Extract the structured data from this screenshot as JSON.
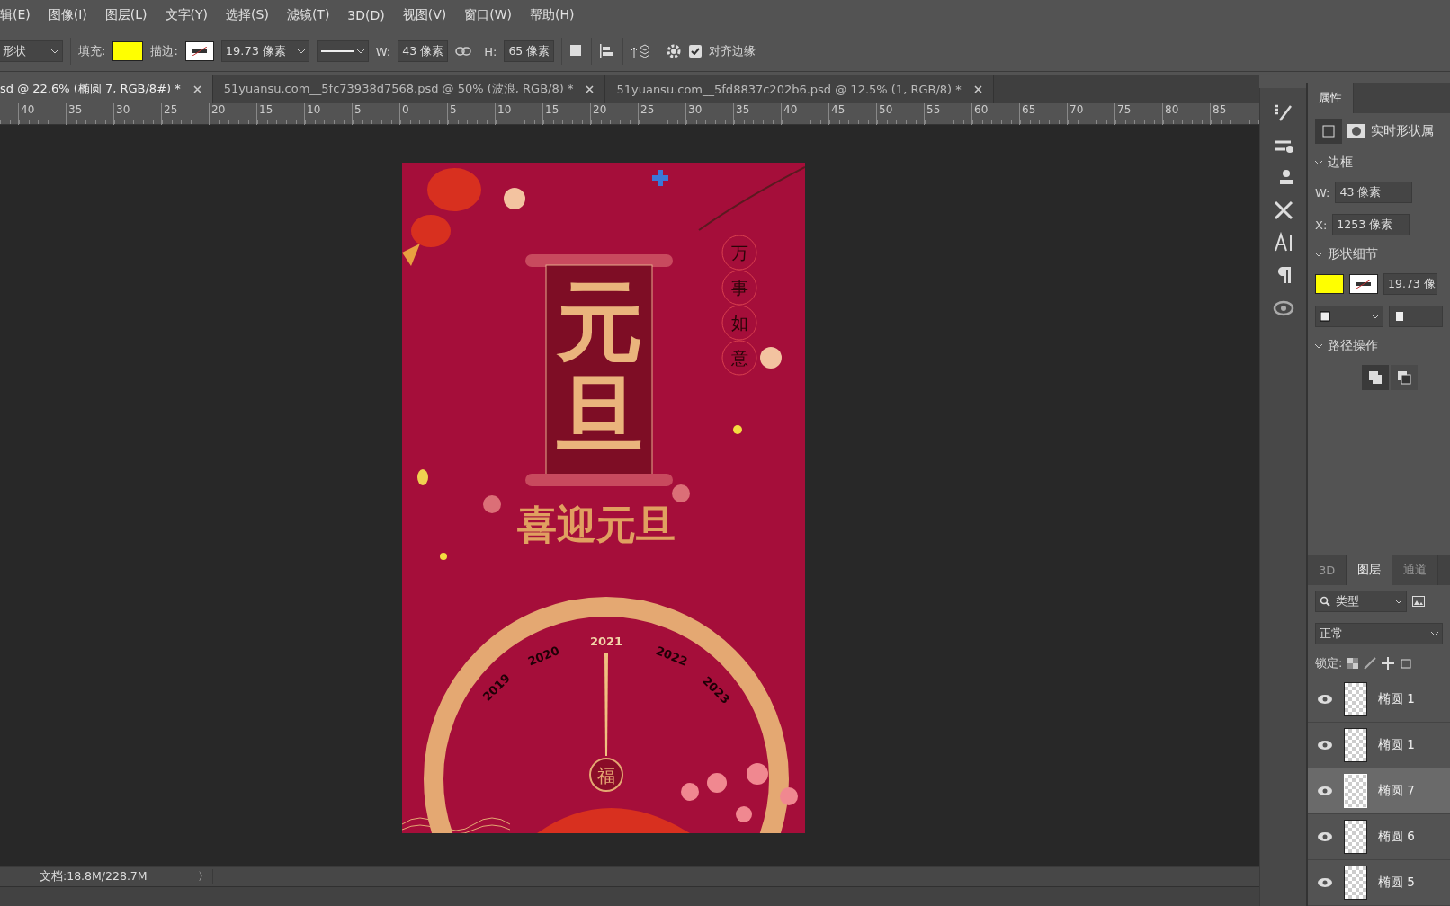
{
  "menu": [
    "辑(E)",
    "图像(I)",
    "图层(L)",
    "文字(Y)",
    "选择(S)",
    "滤镜(T)",
    "3D(D)",
    "视图(V)",
    "窗口(W)",
    "帮助(H)"
  ],
  "options": {
    "tool_preset": "形状",
    "fill_label": "填充:",
    "stroke_label": "描边:",
    "stroke_width": "19.73 像素",
    "width_label": "W:",
    "width": "43 像素",
    "height_label": "H:",
    "height": "65 像素",
    "snap": {
      "label": "对齐边缘",
      "checked": true
    }
  },
  "tabs": [
    {
      "label": "sd @ 22.6% (椭圆 7, RGB/8#) *",
      "selected": true
    },
    {
      "label": "51yuansu.com__5fc73938d7568.psd @ 50% (波浪, RGB/8) *",
      "selected": false
    },
    {
      "label": "51yuansu.com__5fd8837c202b6.psd @ 12.5% (1, RGB/8) *",
      "selected": false
    }
  ],
  "ruler": [
    "40",
    "35",
    "30",
    "25",
    "20",
    "15",
    "10",
    "5",
    "0",
    "5",
    "10",
    "15",
    "20",
    "25",
    "30",
    "35",
    "40",
    "45",
    "50",
    "55",
    "60",
    "65",
    "70",
    "75",
    "80",
    "85"
  ],
  "poster": {
    "scroll_text": "元旦",
    "blessing": "万事如意",
    "headline": "喜迎元旦",
    "years": [
      "2019",
      "2020",
      "2021",
      "2022",
      "2023"
    ],
    "seal": "福"
  },
  "status_bar": {
    "doc": "文档:18.8M/228.7M",
    "arrow": "〉"
  },
  "properties": {
    "title": "属性",
    "mode": "实时形状属",
    "sections": [
      {
        "title": "边框"
      },
      {
        "title": "形状细节"
      },
      {
        "title": "路径操作"
      }
    ],
    "w_label": "W:",
    "w": "43 像素",
    "x_label": "X:",
    "x": "1253 像素",
    "stroke_width": "19.73 像"
  },
  "layers_panel": {
    "tabs": [
      {
        "label": "3D",
        "selected": false
      },
      {
        "label": "图层",
        "selected": true
      },
      {
        "label": "通道",
        "selected": false
      }
    ],
    "filter": "类型",
    "blend": "正常",
    "lock_label": "锁定:",
    "layers": [
      {
        "name": "椭圆 1",
        "visible": true,
        "selected": false
      },
      {
        "name": "椭圆 1",
        "visible": true,
        "selected": false
      },
      {
        "name": "椭圆 7",
        "visible": true,
        "selected": true
      },
      {
        "name": "椭圆 6",
        "visible": true,
        "selected": false
      },
      {
        "name": "椭圆 5",
        "visible": true,
        "selected": false
      }
    ]
  }
}
